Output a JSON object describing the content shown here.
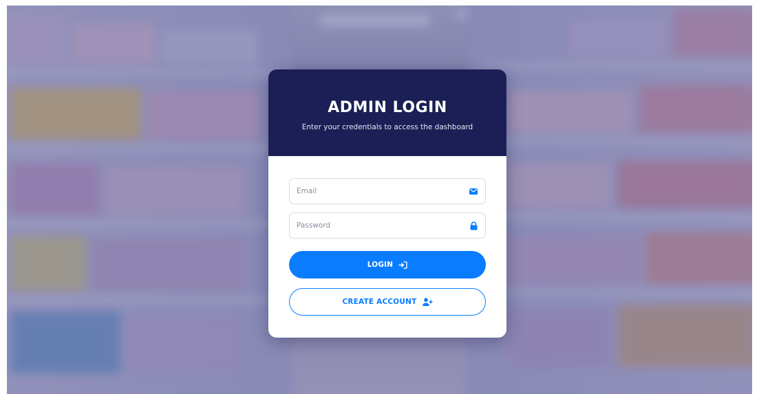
{
  "login_card": {
    "title": "ADMIN LOGIN",
    "subtitle": "Enter your credentials to access the dashboard",
    "email_field": {
      "placeholder": "Email",
      "value": "",
      "icon": "envelope-icon"
    },
    "password_field": {
      "placeholder": "Password",
      "value": "",
      "icon": "lock-icon"
    },
    "login_button": {
      "label": "LOGIN",
      "icon": "sign-in-icon"
    },
    "create_account_button": {
      "label": "CREATE ACCOUNT",
      "icon": "user-plus-icon"
    }
  },
  "colors": {
    "header_bg": "#1b1f56",
    "accent": "#0a7cff",
    "card_bg": "#ffffff",
    "background_tint": "#46488c"
  }
}
